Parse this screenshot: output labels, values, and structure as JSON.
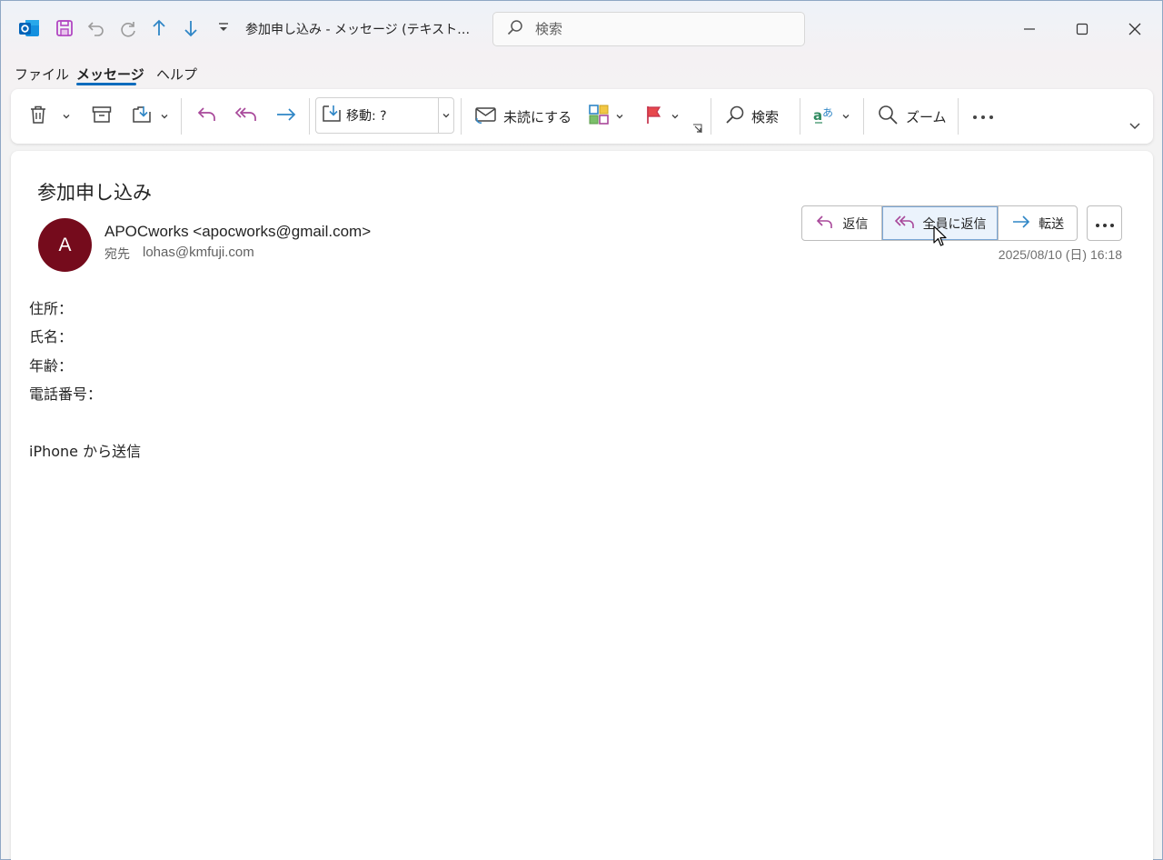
{
  "title_bar": {
    "window_title": "参加申し込み  -  メッセージ (テキスト…",
    "search_placeholder": "検索"
  },
  "menu": {
    "tabs": [
      {
        "label": "ファイル",
        "active": false
      },
      {
        "label": "メッセージ",
        "active": true
      },
      {
        "label": "ヘルプ",
        "active": false
      }
    ]
  },
  "ribbon": {
    "move_label": "移動: ?",
    "mark_unread_label": "未読にする",
    "find_label": "検索",
    "zoom_label": "ズーム"
  },
  "message": {
    "subject": "参加申し込み",
    "avatar_initial": "A",
    "sender": "APOCworks <apocworks@gmail.com>",
    "to_label": "宛先",
    "to_address": "lohas@kmfuji.com",
    "datetime": "2025/08/10 (日) 16:18",
    "actions": {
      "reply": "返信",
      "reply_all": "全員に返信",
      "forward": "転送"
    },
    "body_lines": [
      "住所：",
      "氏名：",
      "年齢：",
      "電話番号：",
      "",
      "iPhone から送信"
    ]
  },
  "colors": {
    "accent": "#0f6cbd",
    "avatar_bg": "#750b1c",
    "reply_purple": "#a8489a",
    "forward_blue": "#2f86c6"
  }
}
